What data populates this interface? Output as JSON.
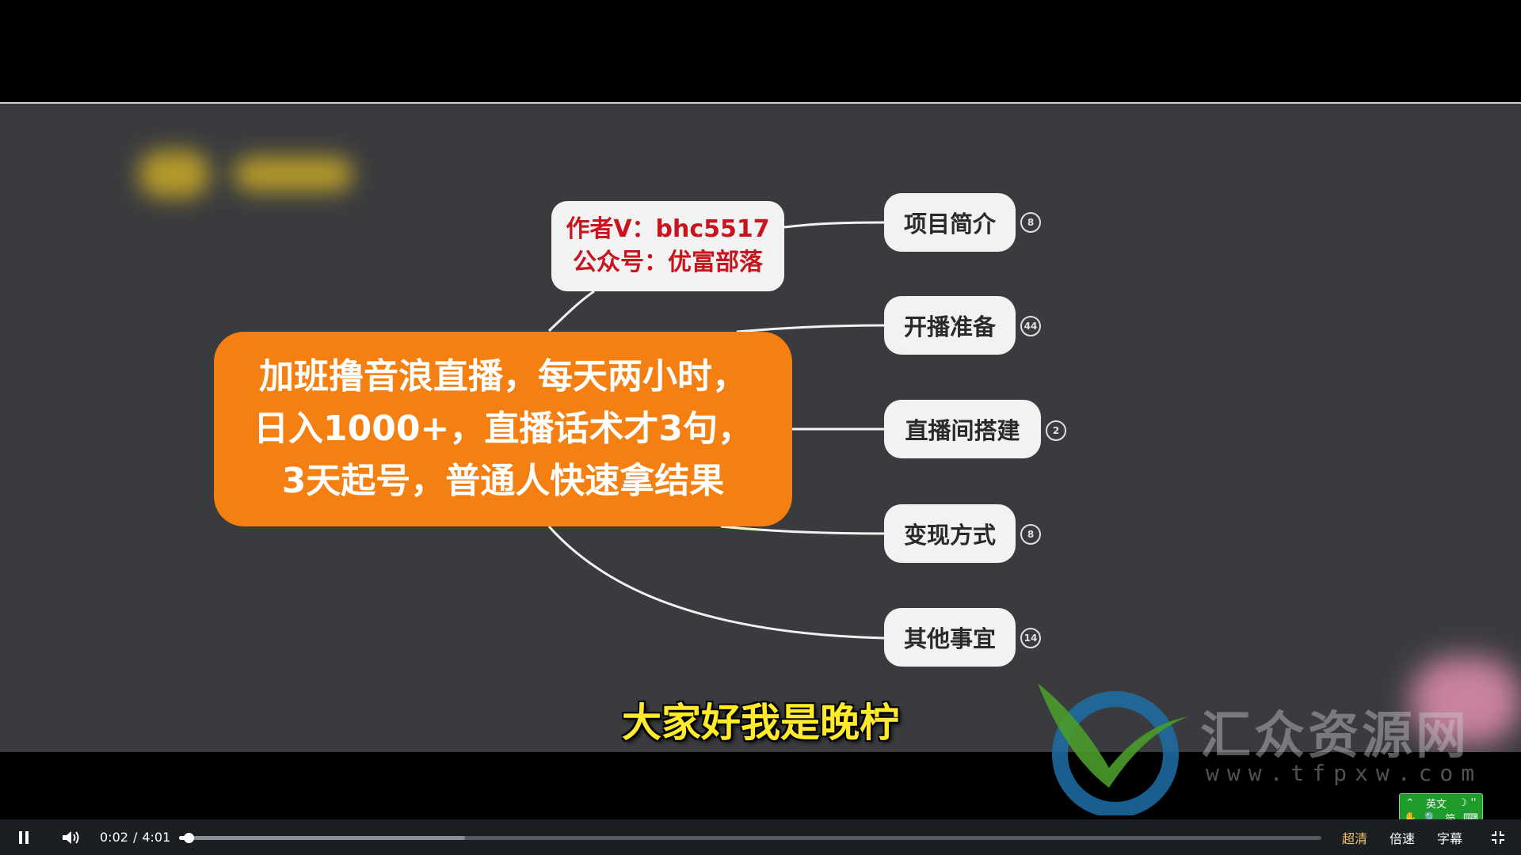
{
  "mindmap": {
    "author_lines": [
      "作者V：bhc5517",
      "公众号：优富部落"
    ],
    "main_topic_lines": [
      "加班撸音浪直播，每天两小时，",
      "日入1000+，直播话术才3句，",
      "3天起号，普通人快速拿结果"
    ],
    "branches": [
      {
        "label": "项目简介",
        "count": "8"
      },
      {
        "label": "开播准备",
        "count": "44"
      },
      {
        "label": "直播间搭建",
        "count": "2"
      },
      {
        "label": "变现方式",
        "count": "8"
      },
      {
        "label": "其他事宜",
        "count": "14"
      }
    ]
  },
  "subtitle": "大家好我是晚柠",
  "watermark": {
    "name": "汇众资源网",
    "url": "www.tfpxw.com"
  },
  "ime_toolbar": {
    "mode": "英文",
    "chars": "简 ",
    "extra": "⌨"
  },
  "player": {
    "current_time": "0:02",
    "separator": "/",
    "duration": "4:01",
    "progress_fraction": 0.0083,
    "buffered_fraction": 0.25,
    "quality_label": "超清",
    "speed_label": "倍速",
    "subtitle_label": "字幕",
    "pause_icon": "pause-icon",
    "volume_icon": "volume-icon",
    "exit_fullscreen_icon": "exit-fullscreen-icon"
  },
  "colors": {
    "main_topic": "#f47f12",
    "author_text": "#c8141e",
    "subtitle_text": "#ffeb2a",
    "hd_label": "#f2c26b"
  }
}
